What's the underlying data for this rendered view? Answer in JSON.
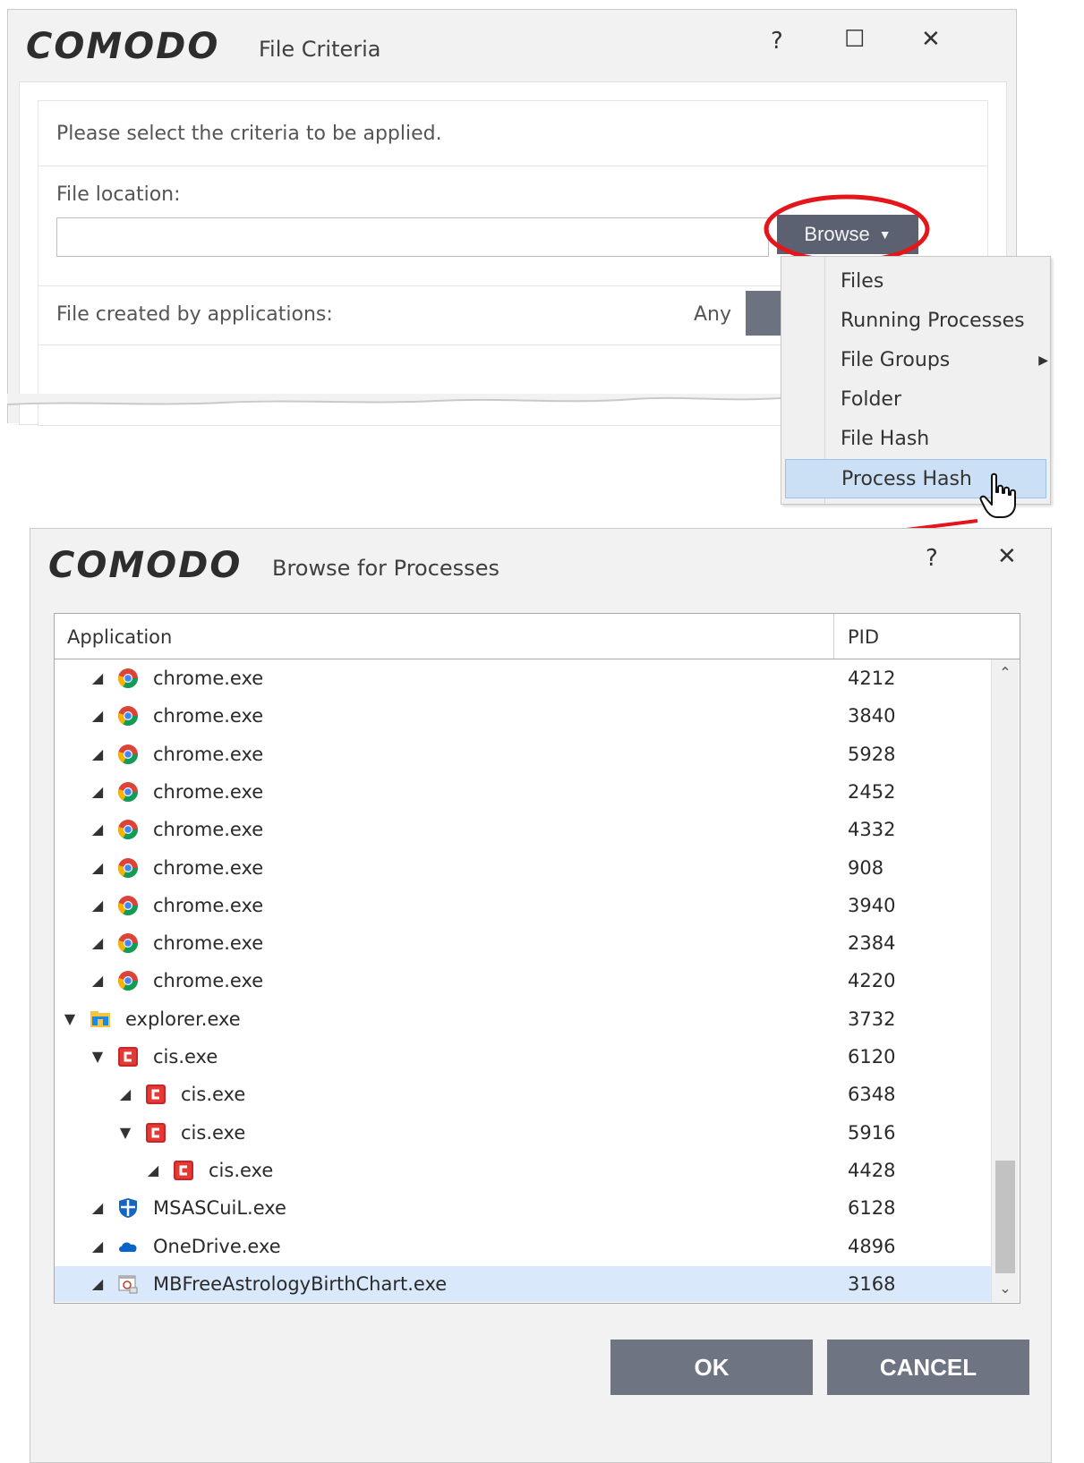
{
  "criteria_dialog": {
    "logo": "COMODO",
    "title": "File Criteria",
    "help_label": "?",
    "maximize_label": "☐",
    "close_label": "✕",
    "instruction": "Please select the criteria to be applied.",
    "file_location_label": "File location:",
    "file_location_value": "",
    "browse_label": "Browse",
    "created_by_label": "File created by applications:",
    "created_by_value": "Any"
  },
  "browse_menu": {
    "items": [
      {
        "label": "Files"
      },
      {
        "label": "Running Processes"
      },
      {
        "label": "File Groups",
        "has_submenu": true
      },
      {
        "label": "Folder"
      },
      {
        "label": "File Hash"
      },
      {
        "label": "Process Hash",
        "highlighted": true
      }
    ],
    "submenu_arrow": "▶"
  },
  "process_dialog": {
    "logo": "COMODO",
    "title": "Browse for Processes",
    "help_label": "?",
    "close_label": "✕",
    "columns": {
      "application": "Application",
      "pid": "PID"
    },
    "rows": [
      {
        "name": "chrome.exe",
        "pid": "4212",
        "icon": "chrome-icon",
        "level": 1,
        "expander": "collapsed"
      },
      {
        "name": "chrome.exe",
        "pid": "3840",
        "icon": "chrome-icon",
        "level": 1,
        "expander": "collapsed"
      },
      {
        "name": "chrome.exe",
        "pid": "5928",
        "icon": "chrome-icon",
        "level": 1,
        "expander": "collapsed"
      },
      {
        "name": "chrome.exe",
        "pid": "2452",
        "icon": "chrome-icon",
        "level": 1,
        "expander": "collapsed"
      },
      {
        "name": "chrome.exe",
        "pid": "4332",
        "icon": "chrome-icon",
        "level": 1,
        "expander": "collapsed"
      },
      {
        "name": "chrome.exe",
        "pid": "908",
        "icon": "chrome-icon",
        "level": 1,
        "expander": "collapsed"
      },
      {
        "name": "chrome.exe",
        "pid": "3940",
        "icon": "chrome-icon",
        "level": 1,
        "expander": "collapsed"
      },
      {
        "name": "chrome.exe",
        "pid": "2384",
        "icon": "chrome-icon",
        "level": 1,
        "expander": "collapsed"
      },
      {
        "name": "chrome.exe",
        "pid": "4220",
        "icon": "chrome-icon",
        "level": 1,
        "expander": "collapsed"
      },
      {
        "name": "explorer.exe",
        "pid": "3732",
        "icon": "folder-icon",
        "level": 0,
        "expander": "expanded"
      },
      {
        "name": "cis.exe",
        "pid": "6120",
        "icon": "comodo-icon",
        "level": 1,
        "expander": "expanded"
      },
      {
        "name": "cis.exe",
        "pid": "6348",
        "icon": "comodo-icon",
        "level": 2,
        "expander": "collapsed"
      },
      {
        "name": "cis.exe",
        "pid": "5916",
        "icon": "comodo-icon",
        "level": 2,
        "expander": "expanded"
      },
      {
        "name": "cis.exe",
        "pid": "4428",
        "icon": "comodo-icon",
        "level": 3,
        "expander": "collapsed"
      },
      {
        "name": "MSASCuiL.exe",
        "pid": "6128",
        "icon": "defender-icon",
        "level": 1,
        "expander": "collapsed"
      },
      {
        "name": "OneDrive.exe",
        "pid": "4896",
        "icon": "onedrive-icon",
        "level": 1,
        "expander": "collapsed"
      },
      {
        "name": "MBFreeAstrologyBirthChart.exe",
        "pid": "3168",
        "icon": "app-icon",
        "level": 1,
        "expander": "collapsed",
        "selected": true
      }
    ],
    "scroll_up": "⌃",
    "scroll_down": "⌄",
    "ok_label": "OK",
    "cancel_label": "CANCEL"
  },
  "colors": {
    "accent_red": "#e5161b",
    "button_gray": "#6f7483",
    "selection_blue": "#d9e8fa"
  }
}
